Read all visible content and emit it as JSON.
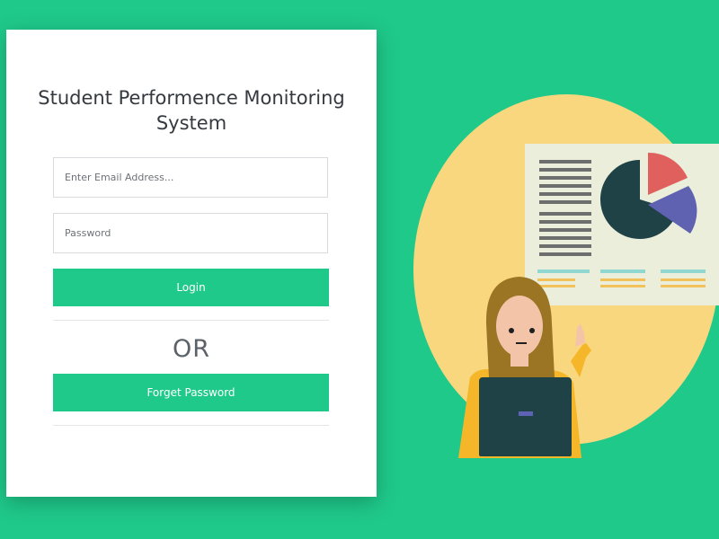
{
  "login_card": {
    "title_line1": "Student Performence Monitoring",
    "title_line2": "System",
    "email_placeholder": "Enter Email Address...",
    "password_placeholder": "Password",
    "login_label": "Login",
    "or_label": "OR",
    "forget_label": "Forget Password"
  },
  "illustration": {
    "icon": "woman-with-laptop-and-pie-chart-board"
  },
  "colors": {
    "background": "#1fc98a",
    "accent_button": "#1fc98a",
    "circle": "#f8d77f",
    "board": "#eaeedb"
  }
}
